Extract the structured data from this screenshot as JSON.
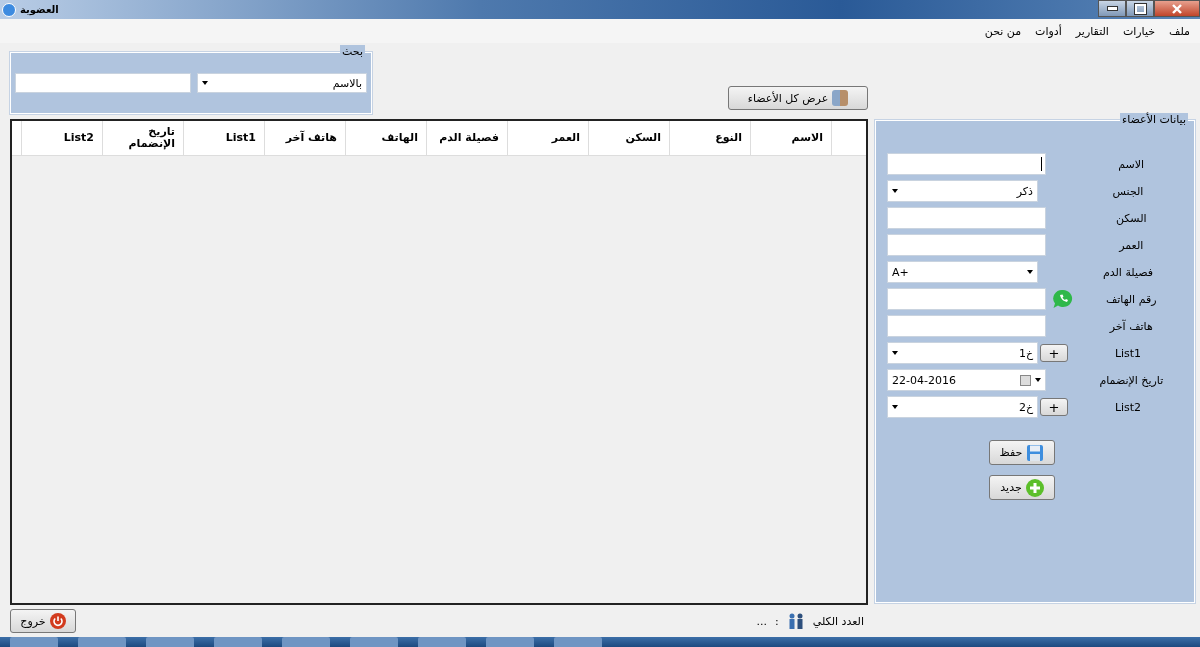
{
  "window": {
    "title": "العضوية"
  },
  "menu": [
    {
      "label": "ملف"
    },
    {
      "label": "خيارات"
    },
    {
      "label": "التقارير"
    },
    {
      "label": "أدوات"
    },
    {
      "label": "من نحن"
    }
  ],
  "search": {
    "title": "بحث",
    "by": "بالاسم"
  },
  "show_all_button": "عرض كل الأعضاء",
  "table": {
    "columns": [
      "الاسم",
      "النوع",
      "السكن",
      "العمر",
      "فصيلة الدم",
      "الهاتف",
      "هاتف آخر",
      "List1",
      "تاريخ الإنضمام",
      "List2"
    ]
  },
  "form": {
    "title": "بيانات الأعضاء",
    "fields": [
      {
        "label": "الاسم",
        "kind": "text",
        "focused": true
      },
      {
        "label": "الجنس",
        "kind": "select",
        "value": "ذكر"
      },
      {
        "label": "السكن",
        "kind": "text"
      },
      {
        "label": "العمر",
        "kind": "text"
      },
      {
        "label": "فصيلة الدم",
        "kind": "select-ltr",
        "value": "A+"
      },
      {
        "label": "رقم الهاتف",
        "kind": "text",
        "chat_icon": true
      },
      {
        "label": "هاتف آخر",
        "kind": "text"
      },
      {
        "label": "List1",
        "kind": "select",
        "value": "خ1",
        "add_button": "+"
      },
      {
        "label": "تاريخ الإنضمام",
        "kind": "date",
        "value": "22-04-2016"
      },
      {
        "label": "List2",
        "kind": "select",
        "value": "خ2",
        "add_button": "+"
      }
    ],
    "save_button": "حفظ",
    "new_button": "جديد"
  },
  "footer": {
    "exit_button": "خروج",
    "count_label": "العدد الكلي",
    "separator": ":",
    "count_value": "..."
  }
}
